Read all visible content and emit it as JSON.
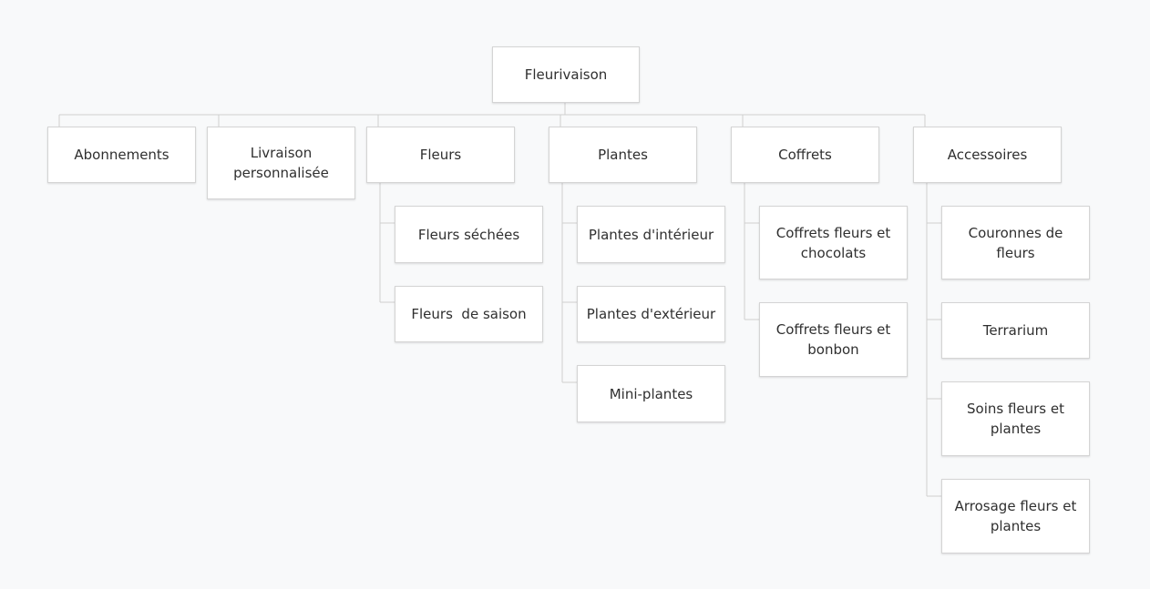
{
  "sitemap": {
    "root": "Fleurivaison",
    "sections": [
      {
        "label": "Abonnements",
        "children": []
      },
      {
        "label": "Livraison personnalisée",
        "children": []
      },
      {
        "label": "Fleurs",
        "children": [
          "Fleurs séchées",
          "Fleurs  de saison"
        ]
      },
      {
        "label": "Plantes",
        "children": [
          "Plantes d'intérieur",
          "Plantes d'extérieur",
          "Mini-plantes"
        ]
      },
      {
        "label": "Coffrets",
        "children": [
          "Coffrets fleurs et chocolats",
          "Coffrets fleurs et bonbon"
        ]
      },
      {
        "label": "Accessoires",
        "children": [
          "Couronnes de fleurs",
          "Terrarium",
          "Soins fleurs et plantes",
          "Arrosage fleurs et plantes"
        ]
      }
    ]
  }
}
